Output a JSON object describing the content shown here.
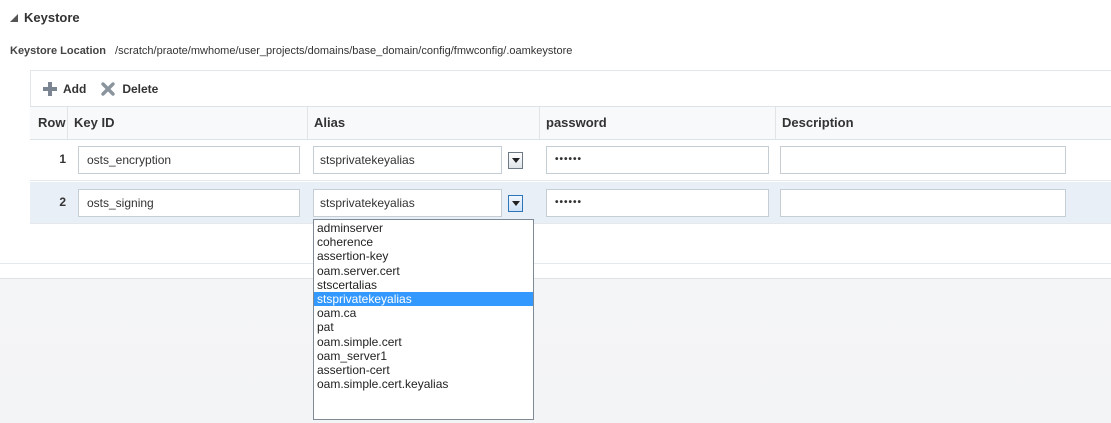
{
  "section": {
    "title": "Keystore"
  },
  "keystore": {
    "location_label": "Keystore Location",
    "location_value": "/scratch/praote/mwhome/user_projects/domains/base_domain/config/fmwconfig/.oamkeystore"
  },
  "toolbar": {
    "add_label": "Add",
    "delete_label": "Delete"
  },
  "table": {
    "columns": [
      "Row",
      "Key ID",
      "Alias",
      "password",
      "Description"
    ],
    "rows": [
      {
        "row": "1",
        "key_id": "osts_encryption",
        "alias": "stsprivatekeyalias",
        "password": "••••••",
        "description": ""
      },
      {
        "row": "2",
        "key_id": "osts_signing",
        "alias": "stsprivatekeyalias",
        "password": "••••••",
        "description": ""
      }
    ]
  },
  "alias_dropdown": {
    "selected": "stsprivatekeyalias",
    "options": [
      "adminserver",
      "coherence",
      "assertion-key",
      "oam.server.cert",
      "stscertalias",
      "stsprivatekeyalias",
      "oam.ca",
      "pat",
      "oam.simple.cert",
      "oam_server1",
      "assertion-cert",
      "oam.simple.cert.keyalias"
    ]
  },
  "colors": {
    "highlight": "#3399ff",
    "selected_row": "#e9eff7"
  }
}
